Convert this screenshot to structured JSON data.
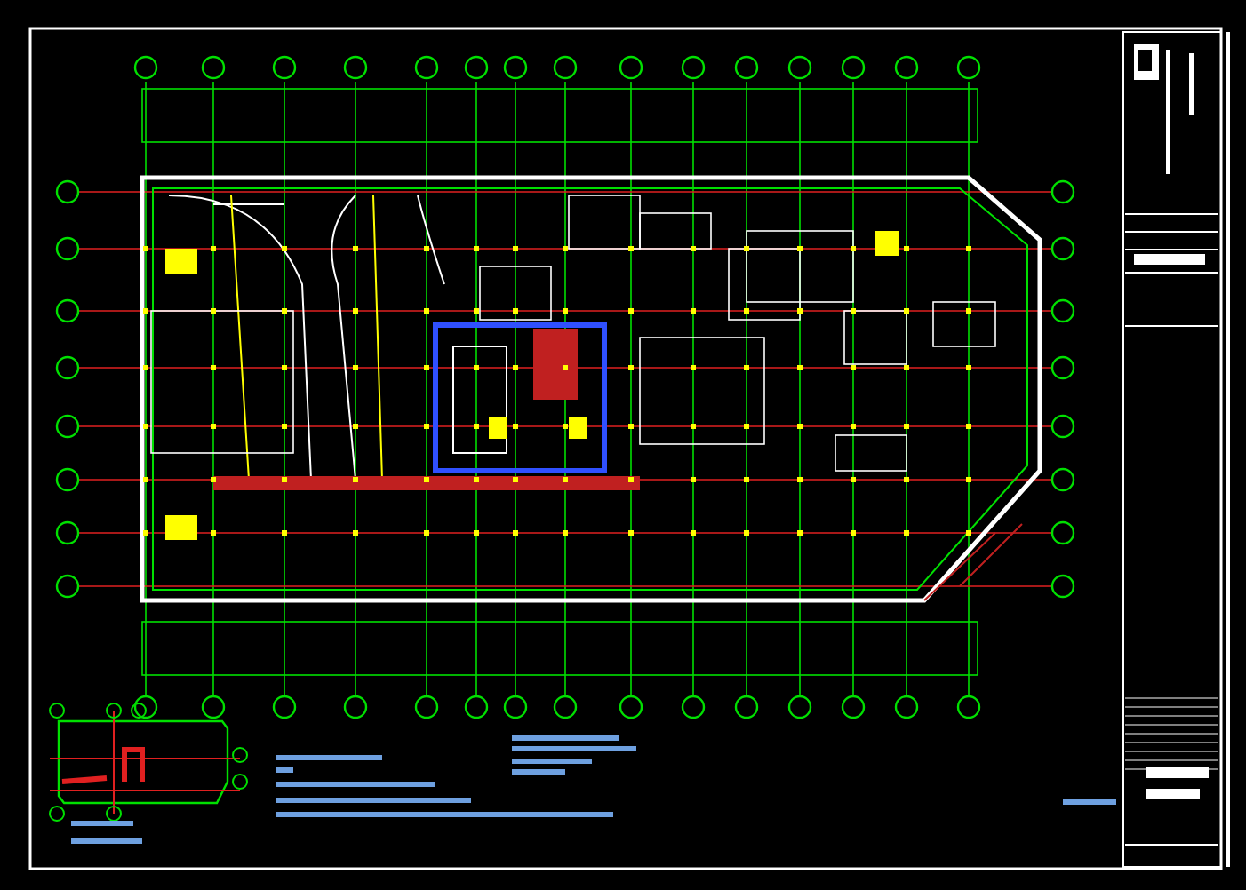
{
  "sheet": {
    "kind": "floor-plan"
  }
}
